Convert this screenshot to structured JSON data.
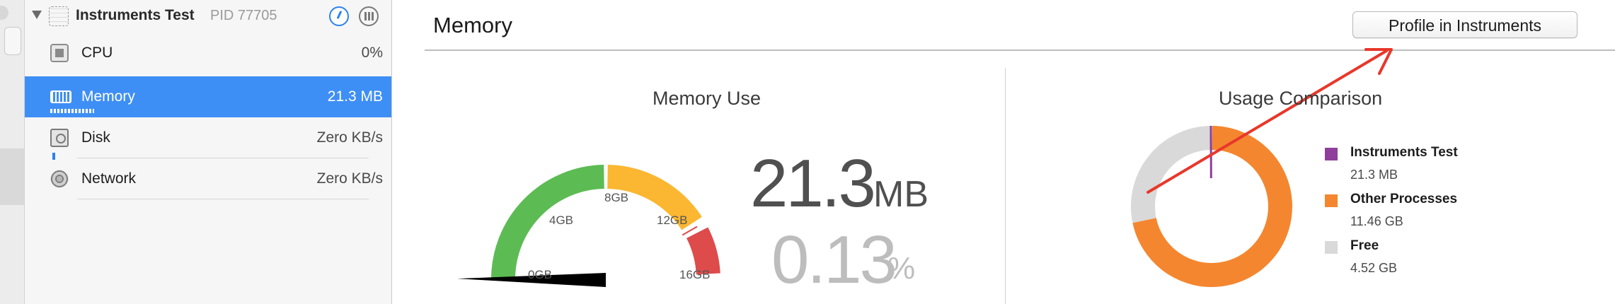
{
  "sidebar": {
    "process": {
      "name": "Instruments Test",
      "pid": "PID 77705"
    },
    "gauges": [
      {
        "label": "CPU",
        "value": "0%",
        "icon": "cpu-icon"
      },
      {
        "label": "Memory",
        "value": "21.3 MB",
        "icon": "memory-chip-icon",
        "selected": true
      },
      {
        "label": "Disk",
        "value": "Zero KB/s",
        "icon": "disk-icon"
      },
      {
        "label": "Network",
        "value": "Zero KB/s",
        "icon": "network-globe-icon"
      }
    ]
  },
  "main": {
    "title": "Memory",
    "profile_button": "Profile in Instruments",
    "memory_use": {
      "heading": "Memory Use",
      "gauge_ticks": [
        "0GB",
        "4GB",
        "8GB",
        "12GB",
        "16GB"
      ],
      "gauge_fraction": 0.0013,
      "value": "21.3",
      "unit": "MB",
      "percent_value": "0.13",
      "percent_unit": "%",
      "colors": {
        "low": "#5dbb54",
        "mid": "#fbb731",
        "high": "#de4b4b"
      }
    },
    "usage_comparison": {
      "heading": "Usage Comparison",
      "items": [
        {
          "name": "Instruments Test",
          "value": "21.3 MB",
          "color": "#8e3e9b",
          "fraction": 0.0013
        },
        {
          "name": "Other Processes",
          "value": "11.46 GB",
          "color": "#f4862f",
          "fraction": 0.717
        },
        {
          "name": "Free",
          "value": "4.52 GB",
          "color": "#d9d9d9",
          "fraction": 0.283
        }
      ]
    }
  },
  "annotation": {
    "color": "#e8372a"
  }
}
